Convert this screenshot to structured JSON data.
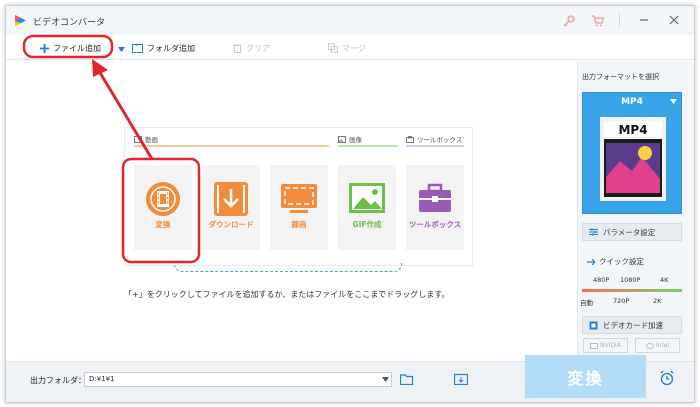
{
  "app": {
    "title": "ビデオコンバータ"
  },
  "toolbar": {
    "add_file": "ファイル追加",
    "add_folder": "フォルダ追加",
    "clear": "クリア",
    "merge": "マージ"
  },
  "sections": {
    "video": "動画",
    "image": "画像",
    "toolbox": "ツールボックス"
  },
  "tiles": [
    {
      "label": "変換",
      "color": "#f28c3a"
    },
    {
      "label": "ダウンロード",
      "color": "#f28c3a"
    },
    {
      "label": "録画",
      "color": "#f28c3a"
    },
    {
      "label": "GIF作成",
      "color": "#6cc04a"
    },
    {
      "label": "ツールボックス",
      "color": "#9b59b6"
    }
  ],
  "hint": "「+」をクリックしてファイルを追加するか、またはファイルをここまでドラッグします。",
  "sidebar": {
    "output_format_title": "出力フォーマットを選択",
    "format": "MP4",
    "format_badge": "MP4",
    "param_settings": "パラメータ設定",
    "quick_settings": "クイック設定",
    "quality_top": [
      "480P",
      "1080P",
      "4K"
    ],
    "quality_bottom": [
      "自動",
      "720P",
      "2K"
    ],
    "gpu_accel": "ビデオカード加速",
    "nvidia": "NVIDIA",
    "intel": "Intel"
  },
  "bottom": {
    "output_folder_label": "出力フォルダ：",
    "output_folder_value": "D:¥1¥1",
    "convert": "変換"
  },
  "colors": {
    "accent": "#38a5e8",
    "highlight": "#e3262d",
    "orange": "#f28c3a"
  }
}
